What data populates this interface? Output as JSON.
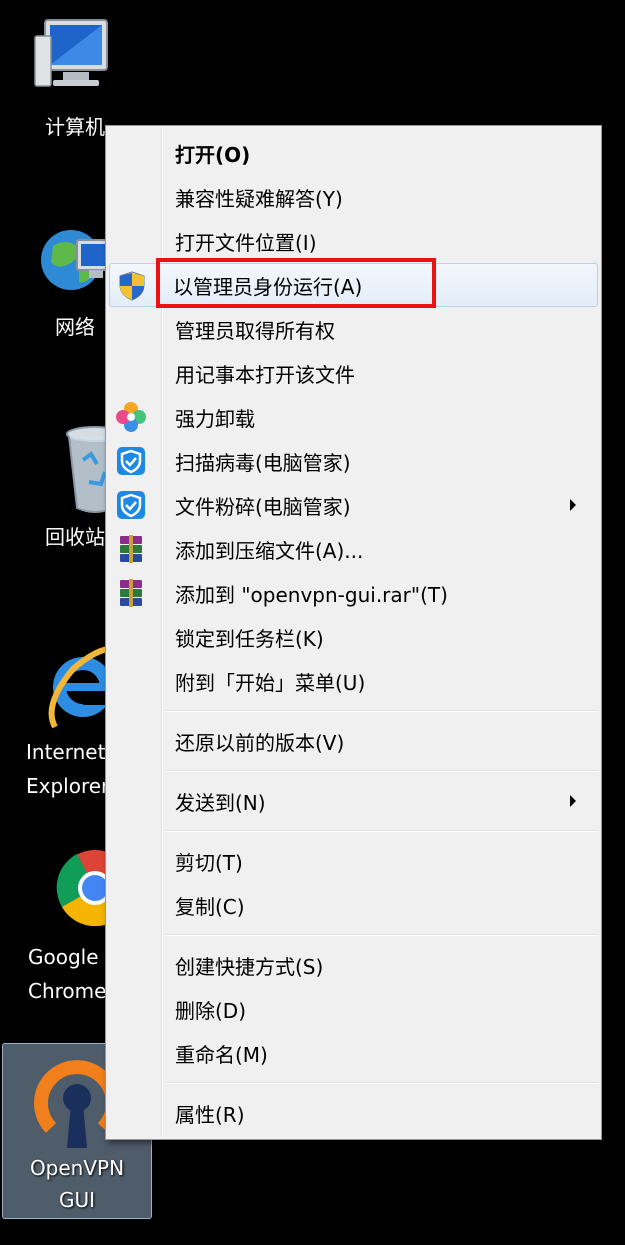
{
  "desktop": {
    "icons": [
      {
        "id": "computer",
        "label": "计算机"
      },
      {
        "id": "network",
        "label": "网络"
      },
      {
        "id": "recycle-bin",
        "label": "回收站"
      },
      {
        "id": "ie",
        "label": "Internet Explorer"
      },
      {
        "id": "chrome",
        "label": "Google Chrome"
      },
      {
        "id": "openvpn",
        "label": "OpenVPN GUI"
      }
    ]
  },
  "context_menu": {
    "items": [
      {
        "label": "打开(O)",
        "icon": "none",
        "bold": true
      },
      {
        "label": "兼容性疑难解答(Y)",
        "icon": "none"
      },
      {
        "label": "打开文件位置(I)",
        "icon": "none"
      },
      {
        "label": "以管理员身份运行(A)",
        "icon": "uac-shield-icon",
        "highlighted": true
      },
      {
        "label": "管理员取得所有权",
        "icon": "none"
      },
      {
        "label": "用记事本打开该文件",
        "icon": "none"
      },
      {
        "label": "强力卸载",
        "icon": "uninstall-petals-icon"
      },
      {
        "label": "扫描病毒(电脑管家)",
        "icon": "pcmanager-shield-icon"
      },
      {
        "label": "文件粉碎(电脑管家)",
        "icon": "pcmanager-shield-icon",
        "submenu": true
      },
      {
        "label": "添加到压缩文件(A)...",
        "icon": "winrar-icon"
      },
      {
        "label": "添加到 \"openvpn-gui.rar\"(T)",
        "icon": "winrar-icon"
      },
      {
        "label": "锁定到任务栏(K)",
        "icon": "none"
      },
      {
        "label": "附到「开始」菜单(U)",
        "icon": "none"
      },
      {
        "label": "还原以前的版本(V)",
        "icon": "none"
      },
      {
        "label": "发送到(N)",
        "icon": "none",
        "submenu": true
      },
      {
        "label": "剪切(T)",
        "icon": "none"
      },
      {
        "label": "复制(C)",
        "icon": "none"
      },
      {
        "label": "创建快捷方式(S)",
        "icon": "none"
      },
      {
        "label": "删除(D)",
        "icon": "none"
      },
      {
        "label": "重命名(M)",
        "icon": "none"
      },
      {
        "label": "属性(R)",
        "icon": "none"
      }
    ]
  },
  "colors": {
    "highlight_border": "#ee1111",
    "menu_background": "#f0f0f0",
    "desktop_background": "#000000"
  }
}
